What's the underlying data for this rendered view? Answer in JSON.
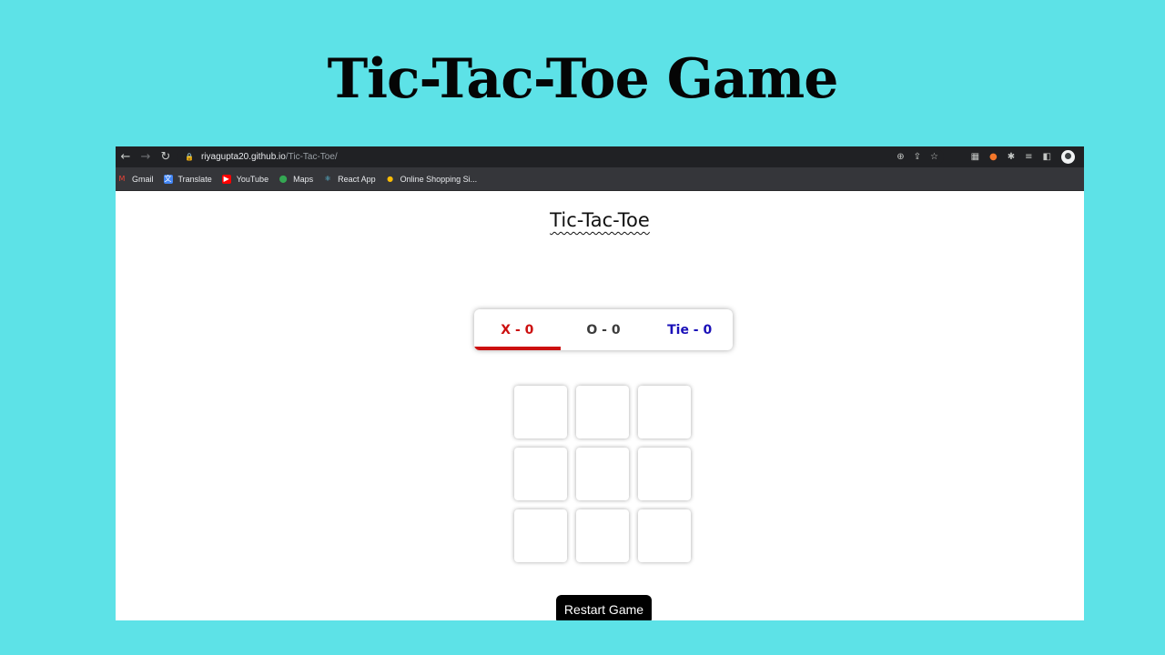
{
  "headline": "Tic-Tac-Toe Game",
  "browser": {
    "url_host": "riyagupta20.github.io",
    "url_path": "/Tic-Tac-Toe/",
    "bookmarks": [
      {
        "label": "Gmail",
        "icon": "gmail-icon",
        "color": "#ea4335",
        "glyph": "M"
      },
      {
        "label": "Translate",
        "icon": "translate-icon",
        "color": "#4285f4",
        "glyph": "文"
      },
      {
        "label": "YouTube",
        "icon": "youtube-icon",
        "color": "#ff0000",
        "glyph": "▶"
      },
      {
        "label": "Maps",
        "icon": "maps-icon",
        "color": "#34a853",
        "glyph": "⬤"
      },
      {
        "label": "React App",
        "icon": "react-icon",
        "color": "#61dafb",
        "glyph": "⚛"
      },
      {
        "label": "Online Shopping Si...",
        "icon": "shopping-icon",
        "color": "#fbbc05",
        "glyph": "●"
      }
    ]
  },
  "game": {
    "title": "Tic-Tac-Toe",
    "scores": {
      "x": "X - 0",
      "o": "O - 0",
      "tie": "Tie - 0"
    },
    "active_player": "X",
    "board": [
      "",
      "",
      "",
      "",
      "",
      "",
      "",
      "",
      ""
    ],
    "restart_label": "Restart Game"
  },
  "colors": {
    "background": "#5de2e7",
    "x": "#cc1010",
    "o": "#3c3c3c",
    "tie": "#1a10b8"
  }
}
